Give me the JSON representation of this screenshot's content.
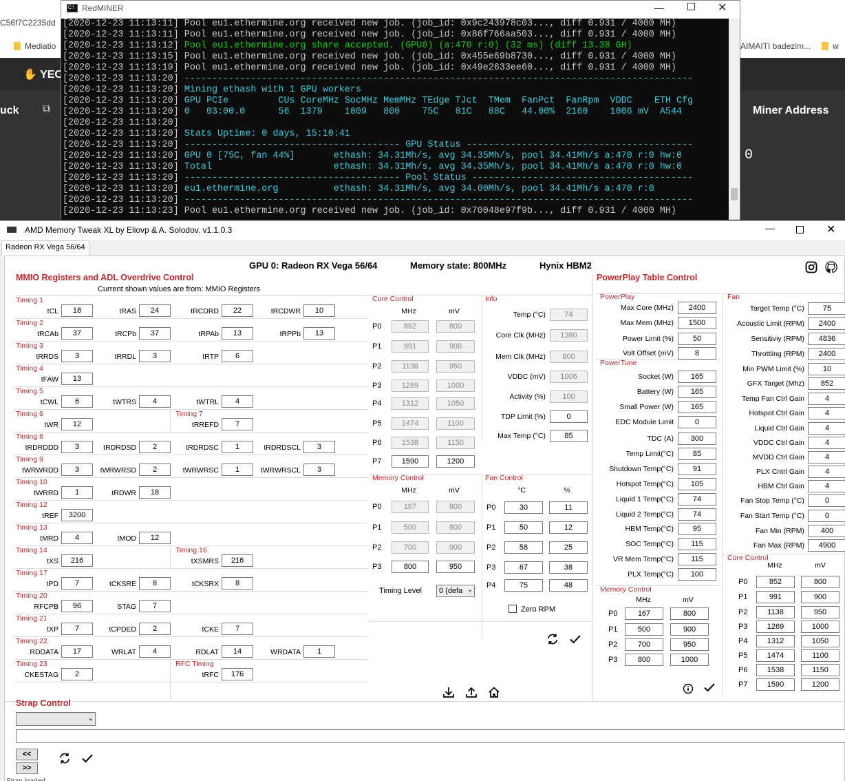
{
  "background": {
    "url_fragment": "C56f7C2235dd",
    "tab_mediatio": "Mediatio",
    "tab_aimaiti": "AIMAITI badezim...",
    "tab_w": "w",
    "nav_yec": "YEC",
    "nav_uck": "uck",
    "miner_address_label": "Miner Address",
    "zero_value": "0"
  },
  "terminal": {
    "title": "RedMINER",
    "lines": [
      {
        "text": "[2020-12-23 11:13:11] Pool eu1.ethermine.org received new job. (job_id: 0x9c243978c03..., diff 0.931 / 4000 MH)",
        "color": "#c8c8c8"
      },
      {
        "text": "[2020-12-23 11:13:11] Pool eu1.ethermine.org received new job. (job_id: 0x86f766aa503..., diff 0.931 / 4000 MH)",
        "color": "#c8c8c8"
      },
      {
        "text": "[2020-12-23 11:13:12] ",
        "color": "#c8c8c8",
        "rest": "Pool eu1.ethermine.org share accepted. (GPU0) (a:470 r:0) (32 ms) (diff 13.38 GH)",
        "rest_color": "#16c60c"
      },
      {
        "text": "[2020-12-23 11:13:15] Pool eu1.ethermine.org received new job. (job_id: 0x455e69b8730..., diff 0.931 / 4000 MH)",
        "color": "#c8c8c8"
      },
      {
        "text": "[2020-12-23 11:13:19] Pool eu1.ethermine.org received new job. (job_id: 0x49e2633ee60..., diff 0.931 / 4000 MH)",
        "color": "#c8c8c8"
      },
      {
        "text": "[2020-12-23 11:13:20] ",
        "color": "#c8c8c8",
        "rest": "--------------------------------------------------------------------------------------------",
        "rest_color": "#3ac8d8"
      },
      {
        "text": "[2020-12-23 11:13:20] ",
        "color": "#c8c8c8",
        "rest": "Mining ethash with 1 GPU workers",
        "rest_color": "#3ac8d8"
      },
      {
        "text": "[2020-12-23 11:13:20] ",
        "color": "#c8c8c8",
        "rest": "GPU PCIe         CUs CoreMHz SocMHz MemMHz TEdge TJct  TMem  FanPct  FanRpm  VDDC    ETH Cfg",
        "rest_color": "#3ac8d8"
      },
      {
        "text": "[2020-12-23 11:13:20] ",
        "color": "#c8c8c8",
        "rest": "0   03:00.0      56  1379    1009   800    75C   81C   88C   44.00%  2160    1006 mV  A544",
        "rest_color": "#3ac8d8"
      },
      {
        "text": "[2020-12-23 11:13:20]",
        "color": "#c8c8c8"
      },
      {
        "text": "[2020-12-23 11:13:20] ",
        "color": "#c8c8c8",
        "rest": "Stats Uptime: 0 days, 15:10:41",
        "rest_color": "#3ac8d8"
      },
      {
        "text": "[2020-12-23 11:13:20] ",
        "color": "#c8c8c8",
        "rest": "--------------------------------------- GPU Status -----------------------------------------",
        "rest_color": "#3ac8d8"
      },
      {
        "text": "[2020-12-23 11:13:20] ",
        "color": "#c8c8c8",
        "rest": "GPU 0 [75C, fan 44%]       ethash: 34.31Mh/s, avg 34.35Mh/s, pool 34.41Mh/s a:470 r:0 hw:0",
        "rest_color": "#3ac8d8"
      },
      {
        "text": "[2020-12-23 11:13:20] ",
        "color": "#c8c8c8",
        "rest": "Total                      ethash: 34.31Mh/s, avg 34.35Mh/s, pool 34.41Mh/s a:470 r:0 hw:0",
        "rest_color": "#3ac8d8"
      },
      {
        "text": "[2020-12-23 11:13:20] ",
        "color": "#c8c8c8",
        "rest": "--------------------------------------- Pool Status ----------------------------------------",
        "rest_color": "#3ac8d8"
      },
      {
        "text": "[2020-12-23 11:13:20] ",
        "color": "#c8c8c8",
        "rest": "eu1.ethermine.org          ethash: 34.31Mh/s, avg 34.00Mh/s, pool 34.41Mh/s a:470 r:0",
        "rest_color": "#3ac8d8"
      },
      {
        "text": "[2020-12-23 11:13:20] ",
        "color": "#c8c8c8",
        "rest": "--------------------------------------------------------------------------------------------",
        "rest_color": "#3ac8d8"
      },
      {
        "text": "[2020-12-23 11:13:23] Pool eu1.ethermine.org received new job. (job_id: 0x70048e97f9b..., diff 0.931 / 4000 MH)",
        "color": "#c8c8c8"
      }
    ]
  },
  "app": {
    "title": "AMD Memory Tweak XL by Eliovp & A. Solodov. v1.1.0.3",
    "tab": "Radeon RX Vega 56/64",
    "header_gpu": "GPU 0: Radeon RX Vega 56/64",
    "header_mem": "Memory state: 800MHz",
    "header_vendor": "Hynix HBM2"
  },
  "mmio": {
    "title": "MMIO Registers and ADL Overdrive Control",
    "subtitle": "Current shown values are from: MMIO Registers",
    "groups": [
      {
        "title": "Timing 1",
        "fields": [
          {
            "l": "tCL",
            "v": "18"
          },
          {
            "l": "tRAS",
            "v": "24"
          },
          {
            "l": "tRCDRD",
            "v": "22"
          },
          {
            "l": "tRCDWR",
            "v": "10"
          }
        ]
      },
      {
        "title": "Timing 2",
        "fields": [
          {
            "l": "tRCAb",
            "v": "37"
          },
          {
            "l": "tRCPb",
            "v": "37"
          },
          {
            "l": "tRPAb",
            "v": "13"
          },
          {
            "l": "tRPPb",
            "v": "13"
          }
        ]
      },
      {
        "title": "Timing 3",
        "fields": [
          {
            "l": "tRRDS",
            "v": "3"
          },
          {
            "l": "tRRDL",
            "v": "3"
          },
          {
            "l": "tRTP",
            "v": "6"
          }
        ]
      },
      {
        "title": "Timing 4",
        "fields": [
          {
            "l": "tFAW",
            "v": "13"
          }
        ]
      },
      {
        "title": "Timing 5",
        "fields": [
          {
            "l": "tCWL",
            "v": "6"
          },
          {
            "l": "tWTRS",
            "v": "4"
          },
          {
            "l": "tWTRL",
            "v": "4"
          }
        ]
      },
      {
        "title": "Timing 6",
        "title2": "Timing 7",
        "fields": [
          {
            "l": "tWR",
            "v": "12"
          },
          {
            "l": "tRREFD",
            "v": "7"
          }
        ]
      },
      {
        "title": "Timing 8",
        "fields": [
          {
            "l": "tRDRDDD",
            "v": "3"
          },
          {
            "l": "tRDRDSD",
            "v": "2"
          },
          {
            "l": "tRDRDSC",
            "v": "1"
          },
          {
            "l": "tRDRDSCL",
            "v": "3"
          }
        ]
      },
      {
        "title": "Timing 9",
        "fields": [
          {
            "l": "tWRWRDD",
            "v": "3"
          },
          {
            "l": "tWRWRSD",
            "v": "2"
          },
          {
            "l": "tWRWRSC",
            "v": "1"
          },
          {
            "l": "tWRWRSCL",
            "v": "3"
          }
        ]
      },
      {
        "title": "Timing 10",
        "fields": [
          {
            "l": "tWRRD",
            "v": "1"
          },
          {
            "l": "tRDWR",
            "v": "18"
          }
        ]
      },
      {
        "title": "Timing 12",
        "fields": [
          {
            "l": "tREF",
            "v": "3200"
          }
        ]
      },
      {
        "title": "Timing 13",
        "fields": [
          {
            "l": "tMRD",
            "v": "4"
          },
          {
            "l": "tMOD",
            "v": "12"
          }
        ]
      },
      {
        "title": "Timing 14",
        "title2": "Timing 16",
        "fields": [
          {
            "l": "tXS",
            "v": "216"
          },
          {
            "l": "tXSMRS",
            "v": "216"
          }
        ]
      },
      {
        "title": "Timing 17",
        "fields": [
          {
            "l": "tPD",
            "v": "7"
          },
          {
            "l": "tCKSRE",
            "v": "8"
          },
          {
            "l": "tCKSRX",
            "v": "8"
          }
        ]
      },
      {
        "title": "Timing 20",
        "fields": [
          {
            "l": "RFCPB",
            "v": "96"
          },
          {
            "l": "STAG",
            "v": "7"
          }
        ]
      },
      {
        "title": "Timing 21",
        "fields": [
          {
            "l": "tXP",
            "v": "7"
          },
          {
            "l": "tCPDED",
            "v": "2"
          },
          {
            "l": "tCKE",
            "v": "7"
          }
        ]
      },
      {
        "title": "Timing 22",
        "fields": [
          {
            "l": "RDDATA",
            "v": "17"
          },
          {
            "l": "WRLAT",
            "v": "4"
          },
          {
            "l": "RDLAT",
            "v": "14"
          },
          {
            "l": "WRDATA",
            "v": "1"
          }
        ]
      },
      {
        "title": "Timing 23",
        "title2": "RFC Timing",
        "fields": [
          {
            "l": "CKESTAG",
            "v": "2"
          },
          {
            "l": "tRFC",
            "v": "176"
          }
        ]
      }
    ]
  },
  "core_control": {
    "title": "Core Control",
    "col1": "MHz",
    "col2": "mV",
    "rows": [
      {
        "p": "P0",
        "mhz": "852",
        "mv": "800",
        "ro": true
      },
      {
        "p": "P1",
        "mhz": "991",
        "mv": "900",
        "ro": true
      },
      {
        "p": "P2",
        "mhz": "1138",
        "mv": "950",
        "ro": true
      },
      {
        "p": "P3",
        "mhz": "1269",
        "mv": "1000",
        "ro": true
      },
      {
        "p": "P4",
        "mhz": "1312",
        "mv": "1050",
        "ro": true
      },
      {
        "p": "P5",
        "mhz": "1474",
        "mv": "1100",
        "ro": true
      },
      {
        "p": "P6",
        "mhz": "1538",
        "mv": "1150",
        "ro": true
      },
      {
        "p": "P7",
        "mhz": "1590",
        "mv": "1200",
        "ro": false
      }
    ]
  },
  "info": {
    "title": "Info",
    "rows": [
      {
        "l": "Temp (°C)",
        "v": "74",
        "ro": true
      },
      {
        "l": "Core Clk (MHz)",
        "v": "1380",
        "ro": true
      },
      {
        "l": "Mem Clk (MHz)",
        "v": "800",
        "ro": true
      },
      {
        "l": "VDDC (mV)",
        "v": "1006",
        "ro": true
      },
      {
        "l": "Activity (%)",
        "v": "100",
        "ro": true
      },
      {
        "l": "TDP Limit (%)",
        "v": "0",
        "ro": false
      },
      {
        "l": "Max Temp (°C)",
        "v": "85",
        "ro": false
      }
    ]
  },
  "memory_control": {
    "title": "Memory Control",
    "col1": "MHz",
    "col2": "mV",
    "rows": [
      {
        "p": "P0",
        "mhz": "167",
        "mv": "800",
        "ro": true
      },
      {
        "p": "P1",
        "mhz": "500",
        "mv": "800",
        "ro": true
      },
      {
        "p": "P2",
        "mhz": "700",
        "mv": "900",
        "ro": true
      },
      {
        "p": "P3",
        "mhz": "800",
        "mv": "950",
        "ro": false
      }
    ],
    "timing_level_label": "Timing Level",
    "timing_level_value": "0 (defa"
  },
  "fan_control": {
    "title": "Fan Control",
    "col1": "°C",
    "col2": "%",
    "rows": [
      {
        "p": "P0",
        "c": "30",
        "pct": "11"
      },
      {
        "p": "P1",
        "c": "50",
        "pct": "12"
      },
      {
        "p": "P2",
        "c": "58",
        "pct": "25"
      },
      {
        "p": "P3",
        "c": "67",
        "pct": "38"
      },
      {
        "p": "P4",
        "c": "75",
        "pct": "48"
      }
    ],
    "zero_rpm": "Zero RPM"
  },
  "pptable": {
    "title": "PowerPlay Table Control",
    "powerplay_title": "PowerPlay",
    "powerplay": [
      {
        "l": "Max Core (MHz)",
        "v": "2400"
      },
      {
        "l": "Max Mem (MHz)",
        "v": "1500"
      },
      {
        "l": "Power Limit (%)",
        "v": "50"
      },
      {
        "l": "Volt Offset (mV)",
        "v": "8"
      }
    ],
    "powertune_title": "PowerTune",
    "powertune": [
      {
        "l": "Socket (W)",
        "v": "165"
      },
      {
        "l": "Battery (W)",
        "v": "165"
      },
      {
        "l": "Small Power (W)",
        "v": "165"
      },
      {
        "l": "EDC Module Limit",
        "v": "0"
      },
      {
        "l": "TDC (A)",
        "v": "300"
      },
      {
        "l": "Temp Limit(°C)",
        "v": "85"
      },
      {
        "l": "Shutdown Temp(°C)",
        "v": "91"
      },
      {
        "l": "Hotspot Temp(°C)",
        "v": "105"
      },
      {
        "l": "Liquid 1 Temp(°C)",
        "v": "74"
      },
      {
        "l": "Liquid 2 Temp(°C)",
        "v": "74"
      },
      {
        "l": "HBM Temp(°C)",
        "v": "95"
      },
      {
        "l": "SOC Temp(°C)",
        "v": "115"
      },
      {
        "l": "VR Mem Temp(°C)",
        "v": "115"
      },
      {
        "l": "PLX Temp(°C)",
        "v": "100"
      }
    ],
    "mem_title": "Memory Control",
    "mem_col1": "MHz",
    "mem_col2": "mV",
    "mem": [
      {
        "p": "P0",
        "mhz": "167",
        "mv": "800"
      },
      {
        "p": "P1",
        "mhz": "500",
        "mv": "900"
      },
      {
        "p": "P2",
        "mhz": "700",
        "mv": "950"
      },
      {
        "p": "P3",
        "mhz": "800",
        "mv": "1000"
      }
    ],
    "fan_title": "Fan",
    "fan": [
      {
        "l": "Target Temp (°C)",
        "v": "75"
      },
      {
        "l": "Acoustic Limit (RPM)",
        "v": "2400"
      },
      {
        "l": "Sensitiviy (RPM)",
        "v": "4836"
      },
      {
        "l": "Throttling (RPM)",
        "v": "2400"
      },
      {
        "l": "Min PWM Limit (%)",
        "v": "10"
      },
      {
        "l": "GFX Target (Mhz)",
        "v": "852"
      },
      {
        "l": "Temp Fan Ctrl Gain",
        "v": "4"
      },
      {
        "l": "Hotspot Ctrl Gain",
        "v": "4"
      },
      {
        "l": "Liquid Ctrl Gain",
        "v": "4"
      },
      {
        "l": "VDDC Ctrl Gain",
        "v": "4"
      },
      {
        "l": "MVDD Ctrl Gain",
        "v": "4"
      },
      {
        "l": "PLX Cntrl Gain",
        "v": "4"
      },
      {
        "l": "HBM Ctrl Gain",
        "v": "4"
      },
      {
        "l": "Fan Stop Temp (°C)",
        "v": "0"
      },
      {
        "l": "Fan Start Temp (°C)",
        "v": "0"
      },
      {
        "l": "Fan Min (RPM)",
        "v": "400"
      },
      {
        "l": "Fan Max (RPM)",
        "v": "4900"
      }
    ],
    "core_title": "Core Control",
    "core_col1": "MHz",
    "core_col2": "mV",
    "core": [
      {
        "p": "P0",
        "mhz": "852",
        "mv": "800"
      },
      {
        "p": "P1",
        "mhz": "991",
        "mv": "900"
      },
      {
        "p": "P2",
        "mhz": "1138",
        "mv": "950"
      },
      {
        "p": "P3",
        "mhz": "1269",
        "mv": "1000"
      },
      {
        "p": "P4",
        "mhz": "1312",
        "mv": "1050"
      },
      {
        "p": "P5",
        "mhz": "1474",
        "mv": "1100"
      },
      {
        "p": "P6",
        "mhz": "1538",
        "mv": "1150"
      },
      {
        "p": "P7",
        "mhz": "1590",
        "mv": "1200"
      }
    ]
  },
  "strap": {
    "title": "Strap Control",
    "prev": "<<",
    "next": ">>",
    "status": "Strap loaded"
  }
}
